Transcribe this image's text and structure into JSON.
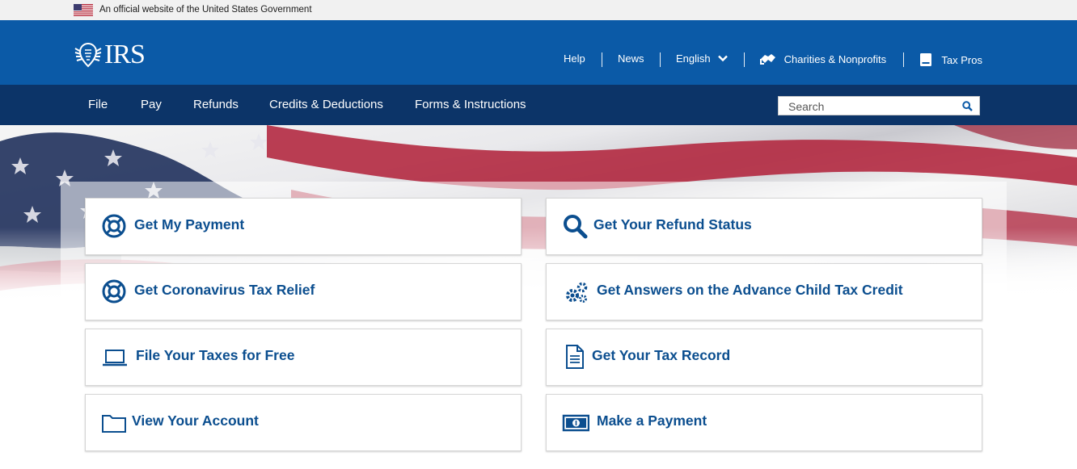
{
  "gov_banner": {
    "text": "An official website of the United States Government"
  },
  "header": {
    "logo_text": "IRS",
    "utility_nav": [
      {
        "label": "Help"
      },
      {
        "label": "News"
      },
      {
        "label": "English"
      },
      {
        "label": "Charities & Nonprofits"
      },
      {
        "label": "Tax Pros"
      }
    ]
  },
  "main_nav": {
    "items": [
      {
        "label": "File"
      },
      {
        "label": "Pay"
      },
      {
        "label": "Refunds"
      },
      {
        "label": "Credits & Deductions"
      },
      {
        "label": "Forms & Instructions"
      }
    ],
    "search": {
      "placeholder": "Search",
      "value": ""
    }
  },
  "cards": [
    {
      "label": "Get My Payment",
      "icon": "lifebuoy-icon"
    },
    {
      "label": "Get Your Refund Status",
      "icon": "magnifier-icon"
    },
    {
      "label": "Get Coronavirus Tax Relief",
      "icon": "lifebuoy-icon"
    },
    {
      "label": "Get Answers on the Advance Child Tax Credit",
      "icon": "gears-icon"
    },
    {
      "label": "File Your Taxes for Free",
      "icon": "laptop-icon"
    },
    {
      "label": "Get Your Tax Record",
      "icon": "document-icon"
    },
    {
      "label": "View Your Account",
      "icon": "folder-icon"
    },
    {
      "label": "Make a Payment",
      "icon": "banknote-icon"
    }
  ],
  "colors": {
    "header_blue": "#0b5aa7",
    "nav_navy": "#0c3468",
    "link_blue": "#0b4e8f",
    "banner_gray": "#f1f1f1"
  }
}
